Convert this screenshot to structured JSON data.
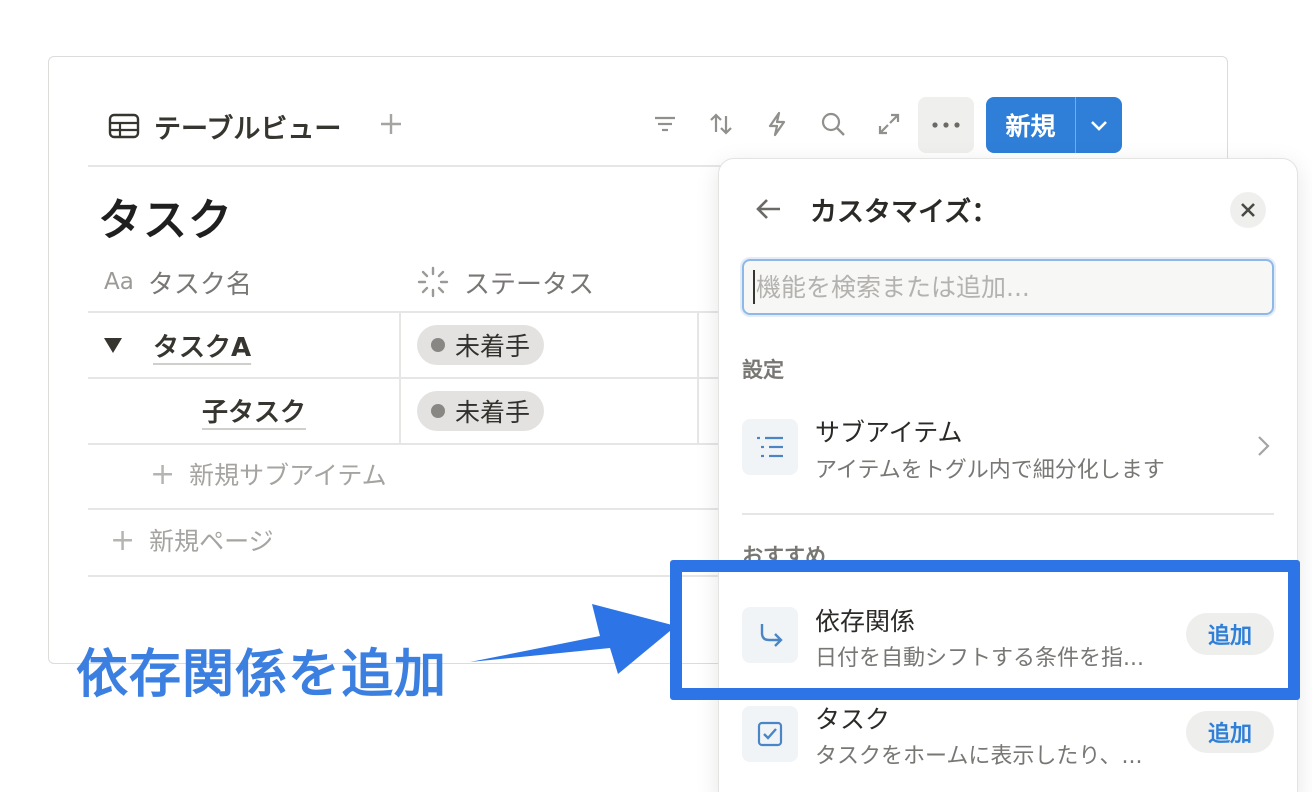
{
  "toolbar": {
    "view_tab_label": "テーブルビュー",
    "new_button_label": "新規",
    "tool_icons": [
      "filter-icon",
      "sort-icon",
      "lightning-icon",
      "search-icon",
      "expand-icon"
    ],
    "more_icon": "more-icon"
  },
  "database": {
    "title": "タスク",
    "columns": [
      {
        "icon": "Aa",
        "label": "タスク名"
      },
      {
        "icon": "status-icon",
        "label": "ステータス"
      }
    ],
    "rows": [
      {
        "name": "タスクA",
        "status": "未着手",
        "toggle": "expanded"
      },
      {
        "name": "子タスク",
        "status": "未着手"
      }
    ],
    "add_subitem_label": "新規サブアイテム",
    "add_page_label": "新規ページ"
  },
  "panel": {
    "title": "カスタマイズ：",
    "search_placeholder": "機能を検索または追加...",
    "settings_label": "設定",
    "settings_items": [
      {
        "title": "サブアイテム",
        "desc": "アイテムをトグル内で細分化します",
        "icon": "sub-items-icon"
      }
    ],
    "recommended_label": "おすすめ",
    "recommended_items": [
      {
        "title": "依存関係",
        "desc": "日付を自動シフトする条件を指...",
        "action": "追加",
        "icon": "dependency-icon"
      },
      {
        "title": "タスク",
        "desc": "タスクをホームに表示したり、...",
        "action": "追加",
        "icon": "checkbox-icon"
      }
    ]
  },
  "annotation": {
    "text": "依存関係を追加",
    "color": "#3b7fe0",
    "box_color": "#2d74e6"
  },
  "colors": {
    "accent": "#2f7fd8",
    "status_pill_bg": "#e3e2e0"
  }
}
